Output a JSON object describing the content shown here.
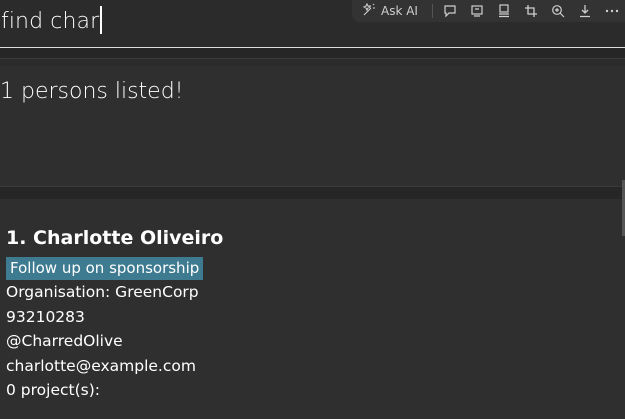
{
  "command": {
    "value": "find char"
  },
  "toolbar": {
    "ask_ai_label": "Ask AI",
    "icons": [
      "ask-ai-icon",
      "comment-icon",
      "screen-icon",
      "display-icon",
      "crop-icon",
      "zoom-in-icon",
      "download-icon",
      "more-icon"
    ]
  },
  "result": {
    "message": "1 persons listed!"
  },
  "persons": [
    {
      "index_name": "1. Charlotte Oliveiro",
      "tag": "Follow up on sponsorship",
      "organisation": "Organisation: GreenCorp",
      "phone": "93210283",
      "handle": "@CharredOlive",
      "email": "charlotte@example.com",
      "projects": "0 project(s):"
    }
  ],
  "colors": {
    "tag_bg": "#3e7b91",
    "background": "#2b2b2b"
  }
}
